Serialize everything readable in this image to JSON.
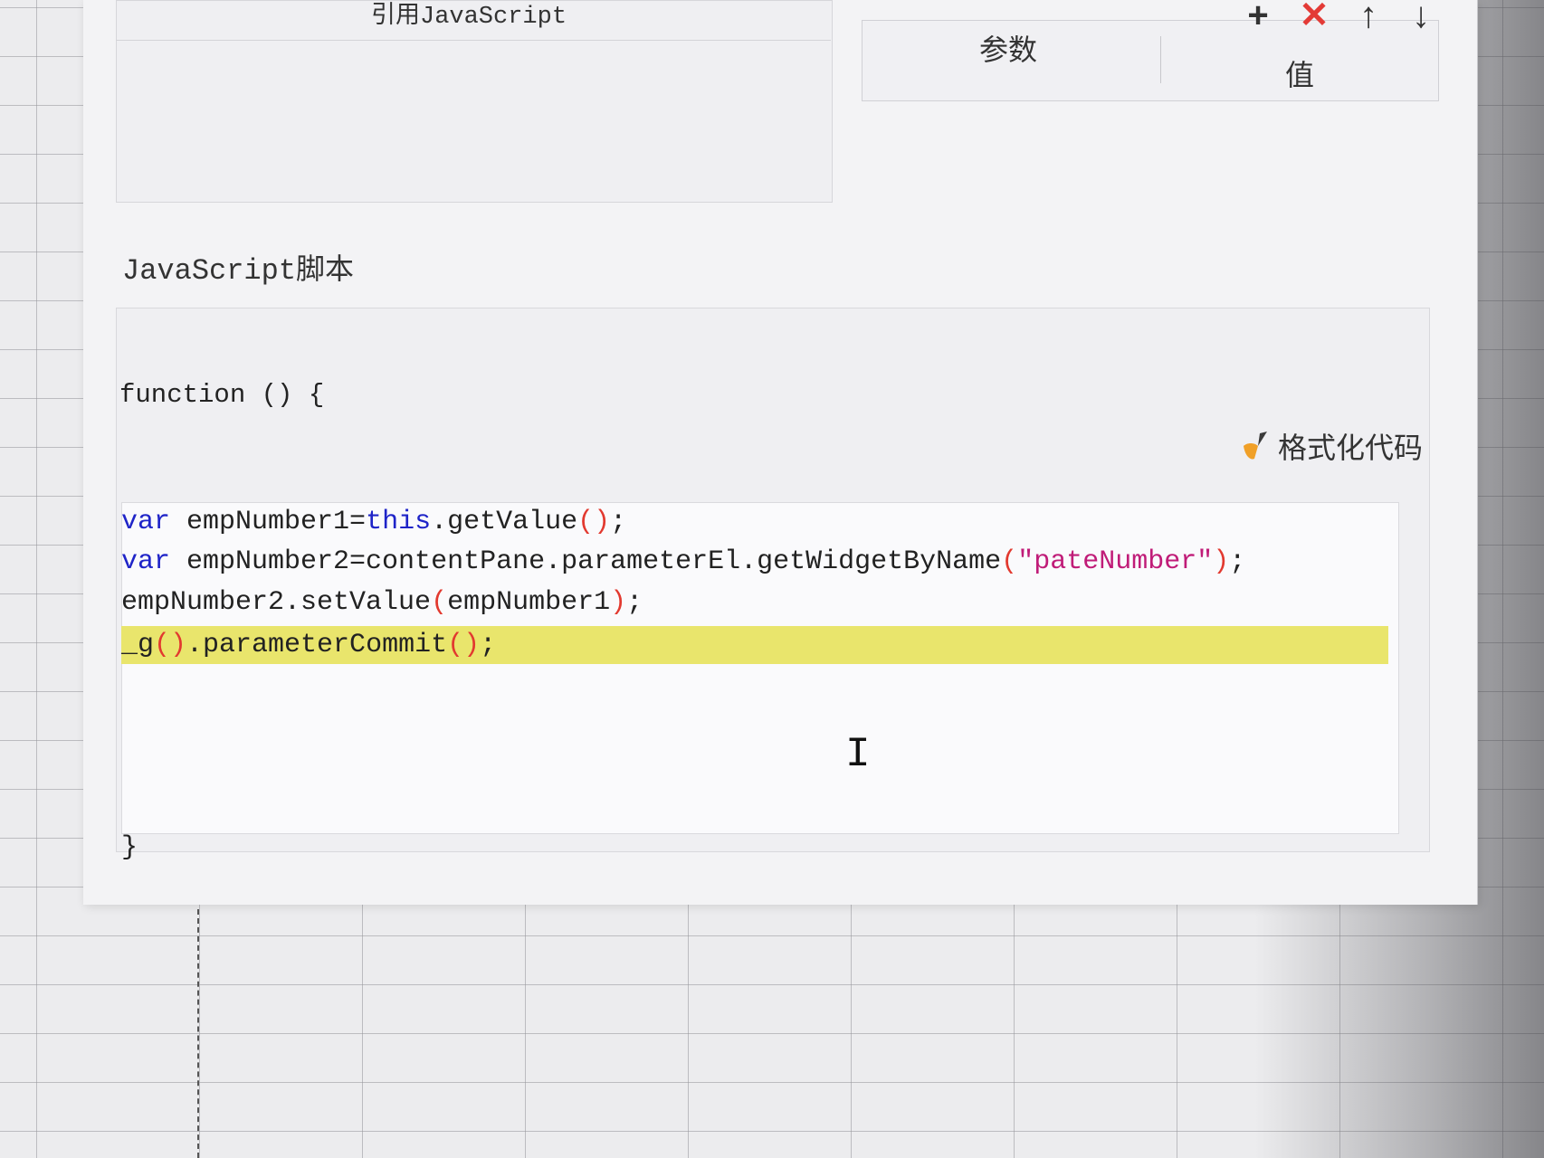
{
  "dialog": {
    "js_ref_label": "引用JavaScript",
    "param_table": {
      "col_params": "参数",
      "col_value": "值"
    },
    "toolbar": {
      "add": "+",
      "delete": "✕",
      "up": "↑",
      "down": "↓"
    },
    "js_script_label": "JavaScript脚本",
    "function_head": "function () {",
    "format_button_label": "格式化代码",
    "code": {
      "line1": {
        "kw": "var",
        "text1": " empNumber1=",
        "kw2": "this",
        "text2": ".getValue",
        "paren": "()",
        "end": ";"
      },
      "line2": {
        "kw": "var",
        "text1": " empNumber2=contentPane.parameterEl.getWidgetByName",
        "paren_open": "(",
        "str": "\"pateNumber\"",
        "paren_close": ")",
        "end": ";"
      },
      "line3": {
        "text1": "empNumber2.setValue",
        "paren_open": "(",
        "arg": "empNumber1",
        "paren_close": ")",
        "end": ";"
      },
      "line4": {
        "text1": "_g",
        "paren": "()",
        "text2": ".parameterCommit",
        "paren2": "()",
        "end": ";"
      }
    },
    "function_close": "}"
  },
  "colors": {
    "keyword": "#1f24c8",
    "paren": "#e2392f",
    "string": "#c01c78",
    "highlight": "#e9e56c",
    "delete_icon": "#e33a36"
  }
}
